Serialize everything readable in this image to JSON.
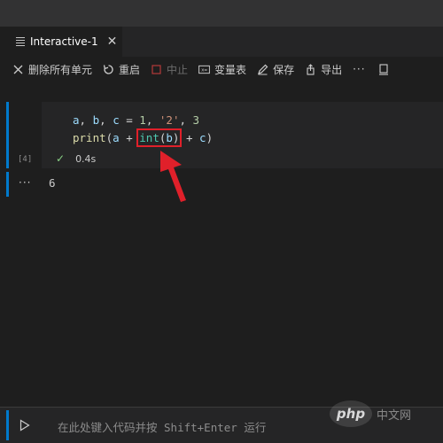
{
  "tab": {
    "title": "Interactive-1",
    "close_glyph": "✕"
  },
  "toolbar": {
    "clear_all_label": "删除所有单元",
    "restart_label": "重启",
    "interrupt_label": "中止",
    "variables_label": "变量表",
    "save_label": "保存",
    "export_label": "导出",
    "more_glyph": "···"
  },
  "cell": {
    "execution_count": "[4]",
    "duration": "0.4s",
    "output": "6",
    "output_prompt": "···"
  },
  "input": {
    "placeholder": "在此处键入代码并按 Shift+Enter 运行"
  },
  "watermark": {
    "logo": "php",
    "text": "中文网"
  },
  "colors": {
    "accent": "#007acc",
    "highlight": "#e0202a",
    "success": "#89d185"
  }
}
